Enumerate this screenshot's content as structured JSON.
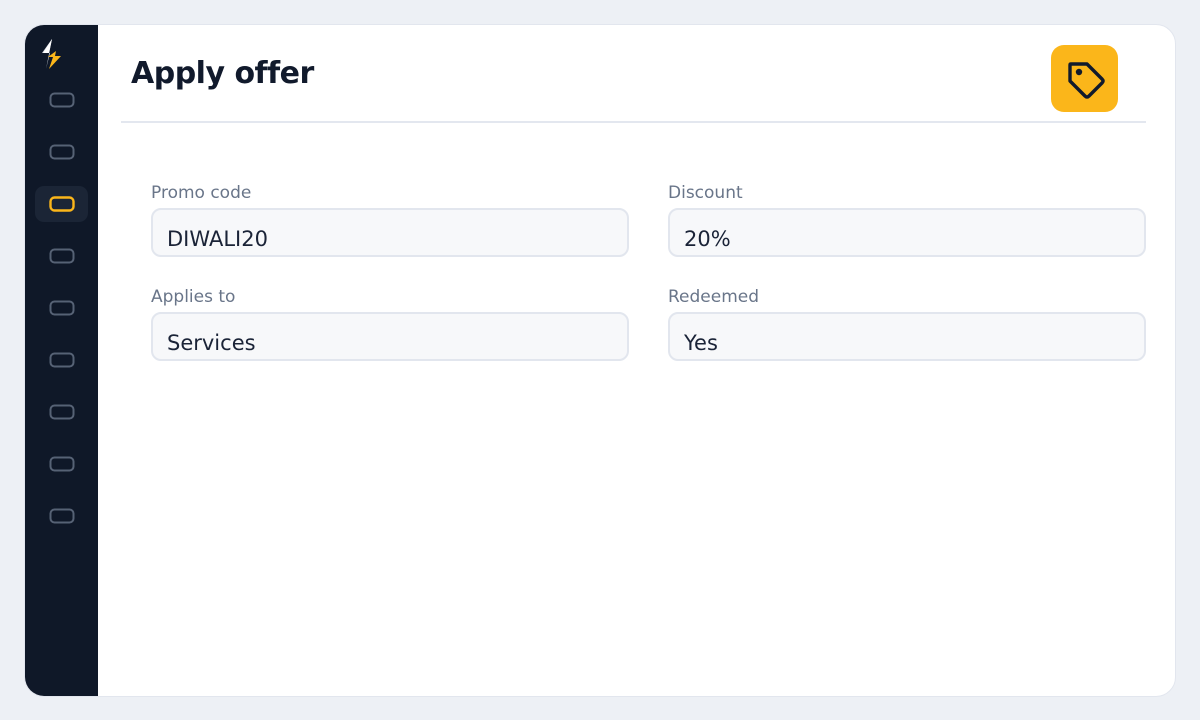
{
  "page": {
    "title": "Apply offer"
  },
  "header": {
    "icon": "tag-icon",
    "icon_bg": "#fbb61a"
  },
  "sidebar": {
    "logo_icon": "bolt-logo-icon",
    "active_index": 2,
    "items": [
      {
        "icon": "nav-icon"
      },
      {
        "icon": "nav-icon"
      },
      {
        "icon": "nav-icon",
        "active": true
      },
      {
        "icon": "nav-icon"
      },
      {
        "icon": "nav-icon"
      },
      {
        "icon": "nav-icon"
      },
      {
        "icon": "nav-icon"
      },
      {
        "icon": "nav-icon"
      },
      {
        "icon": "nav-icon"
      }
    ]
  },
  "form": {
    "fields": [
      {
        "label": "Promo code",
        "value": "DIWALI20"
      },
      {
        "label": "Discount",
        "value": "20%"
      },
      {
        "label": "Applies to",
        "value": "Services"
      },
      {
        "label": "Redeemed",
        "value": "Yes"
      }
    ]
  },
  "colors": {
    "accent": "#fbb61a",
    "sidebar_bg": "#0f1828",
    "page_bg": "#edf0f5"
  }
}
